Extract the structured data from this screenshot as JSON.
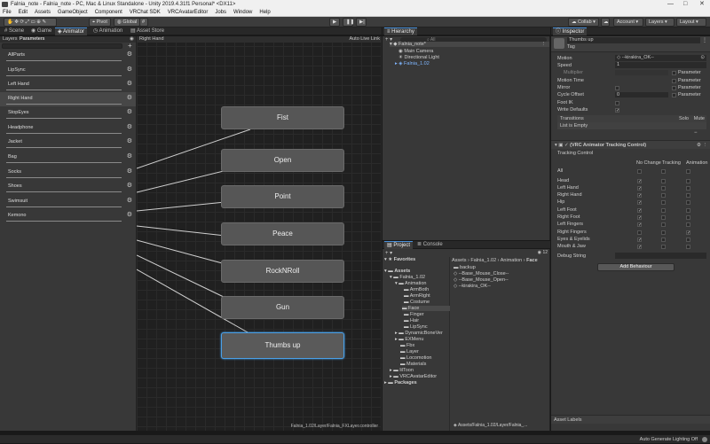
{
  "window": {
    "title": "Falnia_note - Falnia_note - PC, Mac & Linux Standalone - Unity 2019.4.31f1 Personal* <DX11>"
  },
  "menu": [
    "File",
    "Edit",
    "Assets",
    "GameObject",
    "Component",
    "VRChat SDK",
    "VRCAvatarEditor",
    "Jobs",
    "Window",
    "Help"
  ],
  "toolbar": {
    "pivot": "Pivot",
    "global": "Global",
    "collab": "Collab",
    "account": "Account",
    "layers": "Layers",
    "layout": "Layout"
  },
  "left_tabs": [
    "Scene",
    "Game",
    "Animator",
    "Animation",
    "Asset Store"
  ],
  "animator": {
    "subtabs": [
      "Layers",
      "Parameters"
    ],
    "eye_label": "Right Hand",
    "auto_live": "Auto Live Link",
    "params": [
      "AllParts",
      "LipSync",
      "Left Hand",
      "Right Hand",
      "StopEyes",
      "Headphone",
      "Jacket",
      "Bag",
      "Socks",
      "Shoes",
      "Swimsuit",
      "Kemono"
    ],
    "states": [
      "Fist",
      "Open",
      "Point",
      "Peace",
      "RockNRoll",
      "Gun",
      "Thumbs up"
    ],
    "path": "Falnia_1.02/Layer/Falnia_FXLayer.controller"
  },
  "hierarchy": {
    "tab": "Hierarchy",
    "search": "All",
    "items": [
      "Falnia_note*",
      "Main Camera",
      "Directional Light",
      "Falnia_1.02"
    ]
  },
  "project": {
    "tabs": [
      "Project",
      "Console"
    ],
    "count": "12",
    "favorites": "Favorites",
    "assets": "Assets",
    "packages": "Packages",
    "tree": [
      "Falnia_1.02",
      "Animation",
      "ArmBoth",
      "ArmRight",
      "Costume",
      "Face",
      "Finger",
      "Hair",
      "LipSync",
      "DynamicBoneVer",
      "EXMenu",
      "Fbx",
      "Layer",
      "Locomotion",
      "Materials",
      "lilToon",
      "VRCAvatarEditor"
    ],
    "breadcrumb": [
      "Assets",
      "Falnia_1.02",
      "Animation",
      "Face"
    ],
    "files": [
      "backup",
      "--Base_Mouse_Close--",
      "--Base_Mouse_Open--",
      "--kirakira_OK--"
    ],
    "path": "Assets/Falnia_1.02/Layer/Falnia_..."
  },
  "inspector": {
    "tab": "Inspector",
    "state_name": "Thumbs up",
    "tag": "Tag",
    "motion_label": "Motion",
    "motion_value": "--kirakira_OK--",
    "speed_label": "Speed",
    "speed_value": "1",
    "multiplier": "Multiplier",
    "parameter": "Parameter",
    "motion_time": "Motion Time",
    "mirror": "Mirror",
    "cycle_offset": "Cycle Offset",
    "cycle_value": "0",
    "foot_ik": "Foot IK",
    "write_defaults": "Write Defaults",
    "transitions": "Transitions",
    "solo": "Solo",
    "mute": "Mute",
    "list_empty": "List is Empty",
    "component": "(VRC Animator Tracking Control)",
    "tracking_control": "Tracking Control",
    "col_nochange": "No Change",
    "col_tracking": "Tracking",
    "col_animation": "Animation",
    "all": "All",
    "rows": [
      "Head",
      "Left Hand",
      "Right Hand",
      "Hip",
      "Left Foot",
      "Right Foot",
      "Left Fingers",
      "Right Fingers",
      "Eyes & Eyelids",
      "Mouth & Jaw"
    ],
    "debug": "Debug String",
    "add_behaviour": "Add Behaviour",
    "asset_labels": "Asset Labels"
  },
  "status": {
    "right": "Auto Generate Lighting Off"
  },
  "colors": {
    "accent": "#4aa0e8",
    "panel": "#383838",
    "graph": "#202020",
    "node": "#565656"
  }
}
